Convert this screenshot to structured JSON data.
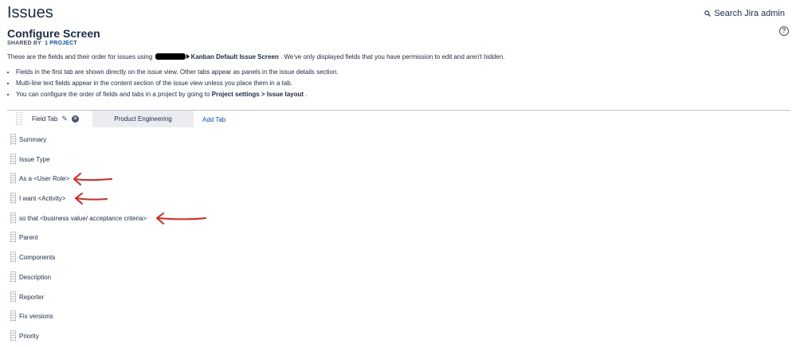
{
  "header": {
    "page_title": "Issues",
    "search_label": "Search Jira admin"
  },
  "screen": {
    "title": "Configure Screen",
    "shared_label": "SHARED BY",
    "project_link": "1 PROJECT",
    "description_prefix": "These are the fields and their order for issues using",
    "screen_name": "Kanban Default Issue Screen",
    "description_suffix": ". We've only displayed fields that you have permission to edit and aren't hidden."
  },
  "bullets": {
    "item1": "Fields in the first tab are shown directly on the issue view. Other tabs appear as panels in the issue details section.",
    "item2": "Multi-line text fields appear in the content section of the issue view unless you place them in a tab.",
    "item3_prefix": "You can configure the order of fields and tabs in a project by going to",
    "item3_bold": "Project settings > Issue layout",
    "item3_suffix": "."
  },
  "tabs": {
    "active": "Field Tab",
    "inactive": "Product Engineering",
    "add_label": "Add Tab"
  },
  "fields": [
    "Summary",
    "Issue Type",
    "As a <User Role>",
    "I want <Activity>",
    "so that <business value/ acceptance criteria>",
    "Parent",
    "Components",
    "Description",
    "Reporter",
    "Fix versions",
    "Priority"
  ],
  "annotation_color": "#e0241b"
}
